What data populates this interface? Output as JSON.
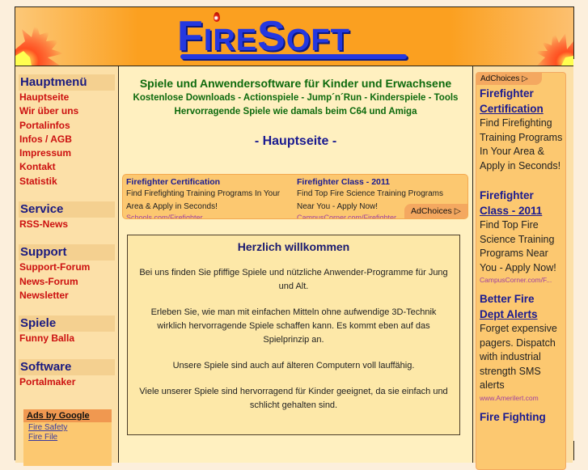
{
  "header": {
    "logo_text_first": "F",
    "logo_text_rest_a": "IRE",
    "logo_text_s": "S",
    "logo_text_rest_b": "OFT",
    "logo_alt": "FireSoft"
  },
  "sidebar": {
    "sections": [
      {
        "title": "Hauptmenü",
        "links": [
          "Hauptseite",
          "Wir über uns",
          "Portalinfos",
          "Infos / AGB",
          "Impressum",
          "Kontakt",
          "Statistik"
        ]
      },
      {
        "title": "Service",
        "links": [
          "RSS-News"
        ]
      },
      {
        "title": "Support",
        "links": [
          "Support-Forum",
          "News-Forum",
          "Newsletter"
        ]
      },
      {
        "title": "Spiele",
        "links": [
          "Funny Balla"
        ]
      },
      {
        "title": "Software",
        "links": [
          "Portalmaker"
        ]
      }
    ],
    "ads": {
      "title": "Ads by Google",
      "links": [
        "Fire Safety",
        "Fire File"
      ]
    }
  },
  "main": {
    "tagline": "Spiele und Anwendersoftware für Kinder und Erwachsene",
    "subtagline_1": "Kostenlose Downloads - Actionspiele - Jump´n´Run - Kinderspiele - Tools",
    "subtagline_2": "Hervorragende Spiele wie damals beim C64 und Amiga",
    "page_heading": "- Hauptseite -",
    "ad_banner": {
      "ads": [
        {
          "title": "Firefighter Certification",
          "desc": "Find Firefighting Training Programs In Your Area & Apply in Seconds!",
          "url": "Schools.com/Firefighter"
        },
        {
          "title": "Firefighter Class - 2011",
          "desc": "Find Top Fire Science Training Programs Near You - Apply Now!",
          "url": "CampusCorner.com/Firefighter"
        }
      ],
      "adchoices": "AdChoices ▷"
    },
    "welcome": {
      "title": "Herzlich willkommen",
      "paragraphs": [
        "Bei uns finden Sie pfiffige Spiele und nützliche Anwender-Programme für Jung und Alt.",
        "Erleben Sie, wie man mit einfachen Mitteln ohne aufwendige 3D-Technik wirklich hervorragende Spiele schaffen kann. Es kommt eben auf das Spielprinzip an.",
        "Unsere Spiele sind auch auf älteren Computern voll lauffähig.",
        "Viele unserer Spiele sind hervorragend für Kinder geeignet, da sie einfach und schlicht gehalten sind."
      ]
    }
  },
  "right_ads": {
    "adchoices": "AdChoices ▷",
    "ads": [
      {
        "title_a": "Firefighter",
        "title_b": "Certification",
        "desc": "Find Firefighting Training Programs In Your Area & Apply in Seconds!",
        "url": ""
      },
      {
        "title_a": "Firefighter",
        "title_b": "Class - 2011",
        "desc": "Find Top Fire Science Training Programs Near You - Apply Now!",
        "url": "CampusCorner.com/F..."
      },
      {
        "title_a": "Better Fire",
        "title_b": "Dept Alerts",
        "desc": "Forget expensive pagers. Dispatch with industrial strength SMS alerts",
        "url": "www.Amerilert.com"
      },
      {
        "title_a": "Fire Fighting",
        "title_b": "",
        "desc": "",
        "url": ""
      }
    ]
  },
  "colors": {
    "page_bg": "#fcefdc",
    "header_orange": "#fba020",
    "logo_blue": "#2438e0",
    "nav_link_red": "#cc1010",
    "nav_head_navy": "#1a1a80",
    "tagline_green": "#0d6a0d",
    "ad_bg": "#fcc870"
  }
}
